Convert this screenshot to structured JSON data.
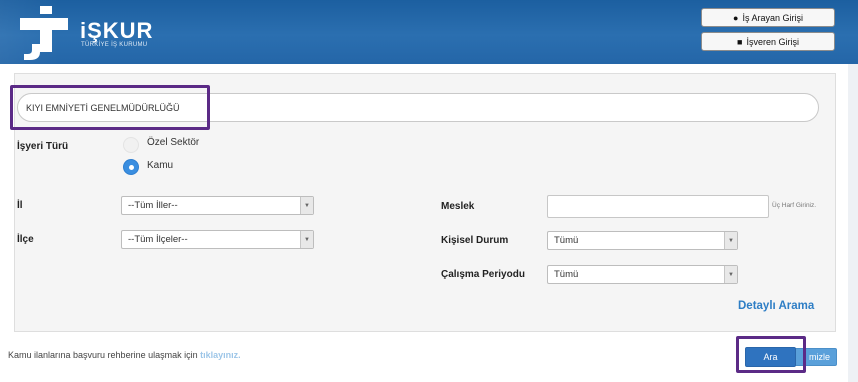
{
  "header": {
    "logo_title": "iŞKUR",
    "logo_subtitle": "TÜRKİYE İŞ KURUMU",
    "job_seeker_login": "İş Arayan Girişi",
    "employer_login": "İşveren Girişi"
  },
  "search_form": {
    "company_value": "KIYI EMNİYETİ GENELMÜDÜRLÜĞÜ",
    "workplace_type": {
      "label": "İşyeri Türü",
      "options": [
        "Özel Sektör",
        "Kamu"
      ],
      "selected": "Kamu"
    },
    "province": {
      "label": "İl",
      "value": "--Tüm İller--"
    },
    "district": {
      "label": "İlçe",
      "value": "--Tüm İlçeler--"
    },
    "occupation": {
      "label": "Meslek",
      "value": "",
      "hint": "Üç Harf Giriniz."
    },
    "personal_status": {
      "label": "Kişisel Durum",
      "value": "Tümü"
    },
    "work_period": {
      "label": "Çalışma Periyodu",
      "value": "Tümü"
    },
    "detailed_search": "Detaylı Arama"
  },
  "footer": {
    "note": "Kamu ilanlarına başvuru rehberine ulaşmak için",
    "note_link": "tıklayınız.",
    "search_button": "Ara",
    "clear_button": "mizle"
  },
  "colors": {
    "header_blue": "#2466a8",
    "accent_blue": "#2e7ec5",
    "highlight_purple": "#5b2a86"
  }
}
